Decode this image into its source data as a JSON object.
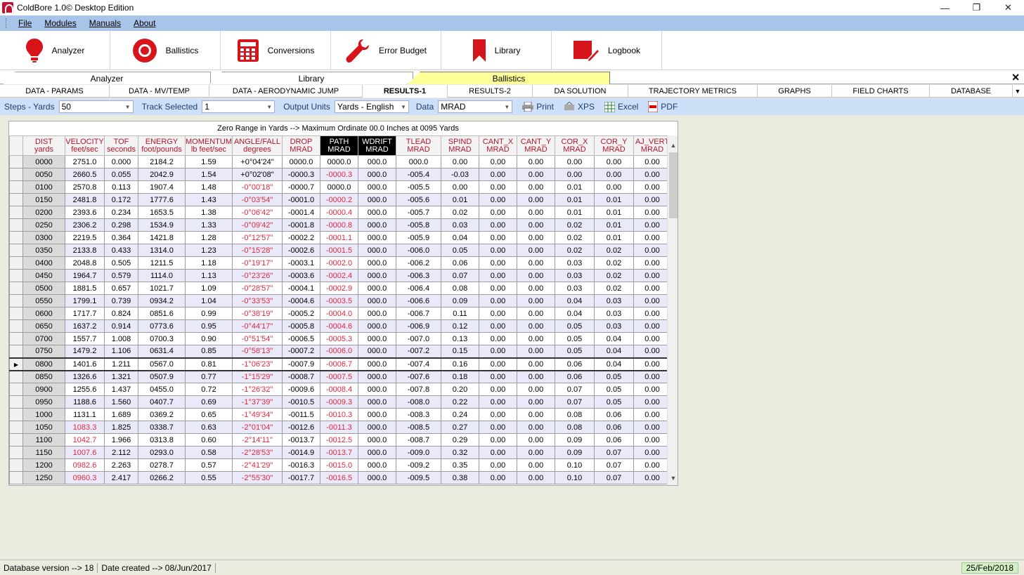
{
  "window": {
    "title": "ColdBore 1.0© Desktop Edition"
  },
  "menu": [
    "File",
    "Modules",
    "Manuals",
    "About"
  ],
  "toolbar": [
    "Analyzer",
    "Ballistics",
    "Conversions",
    "Error Budget",
    "Library",
    "Logbook"
  ],
  "module_tabs": [
    "Analyzer",
    "Library",
    "Ballistics"
  ],
  "sub_tabs": [
    "DATA - PARAMS",
    "DATA - MV/TEMP",
    "DATA - AERODYNAMIC JUMP",
    "RESULTS-1",
    "RESULTS-2",
    "DA SOLUTION",
    "TRAJECTORY METRICS",
    "GRAPHS",
    "FIELD CHARTS",
    "DATABASE"
  ],
  "options": {
    "steps_label": "Steps - Yards",
    "steps_value": "50",
    "track_label": "Track Selected",
    "track_value": "1",
    "units_label": "Output Units",
    "units_value": "Yards - English",
    "data_label": "Data",
    "data_value": "MRAD",
    "print": "Print",
    "xps": "XPS",
    "excel": "Excel",
    "pdf": "PDF"
  },
  "grid": {
    "caption": "Zero Range in Yards --> Maximum Ordinate 00.0 Inches at 0095 Yards",
    "columns": [
      [
        "DIST",
        "yards"
      ],
      [
        "VELOCITY",
        "feet/sec"
      ],
      [
        "TOF",
        "seconds"
      ],
      [
        "ENERGY",
        "foot/pounds"
      ],
      [
        "MOMENTUM",
        "lb feet/sec"
      ],
      [
        "ANGLE/FALL",
        "degrees"
      ],
      [
        "DROP",
        "MRAD"
      ],
      [
        "PATH",
        "MRAD"
      ],
      [
        "WDRIFT",
        "MRAD"
      ],
      [
        "TLEAD",
        "MRAD"
      ],
      [
        "SPIND",
        "MRAD"
      ],
      [
        "CANT_X",
        "MRAD"
      ],
      [
        "CANT_Y",
        "MRAD"
      ],
      [
        "COR_X",
        "MRAD"
      ],
      [
        "COR_Y",
        "MRAD"
      ],
      [
        "AJ_VERT",
        "MRAD"
      ]
    ],
    "rows": [
      [
        "0000",
        "2751.0",
        "0.000",
        "2184.2",
        "1.59",
        "+0°04'24\"",
        "0000.0",
        "0000.0",
        "000.0",
        "000.0",
        "0.00",
        "0.00",
        "0.00",
        "0.00",
        "0.00",
        "0.00"
      ],
      [
        "0050",
        "2660.5",
        "0.055",
        "2042.9",
        "1.54",
        "+0°02'08\"",
        "-0000.3",
        "-0000.3",
        "000.0",
        "-005.4",
        "-0.03",
        "0.00",
        "0.00",
        "0.00",
        "0.00",
        "0.00"
      ],
      [
        "0100",
        "2570.8",
        "0.113",
        "1907.4",
        "1.48",
        "-0°00'18\"",
        "-0000.7",
        "0000.0",
        "000.0",
        "-005.5",
        "0.00",
        "0.00",
        "0.00",
        "0.01",
        "0.00",
        "0.00"
      ],
      [
        "0150",
        "2481.8",
        "0.172",
        "1777.6",
        "1.43",
        "-0°03'54\"",
        "-0001.0",
        "-0000.2",
        "000.0",
        "-005.6",
        "0.01",
        "0.00",
        "0.00",
        "0.01",
        "0.01",
        "0.00"
      ],
      [
        "0200",
        "2393.6",
        "0.234",
        "1653.5",
        "1.38",
        "-0°06'42\"",
        "-0001.4",
        "-0000.4",
        "000.0",
        "-005.7",
        "0.02",
        "0.00",
        "0.00",
        "0.01",
        "0.01",
        "0.00"
      ],
      [
        "0250",
        "2306.2",
        "0.298",
        "1534.9",
        "1.33",
        "-0°09'42\"",
        "-0001.8",
        "-0000.8",
        "000.0",
        "-005.8",
        "0.03",
        "0.00",
        "0.00",
        "0.02",
        "0.01",
        "0.00"
      ],
      [
        "0300",
        "2219.5",
        "0.364",
        "1421.8",
        "1.28",
        "-0°12'57\"",
        "-0002.2",
        "-0001.1",
        "000.0",
        "-005.9",
        "0.04",
        "0.00",
        "0.00",
        "0.02",
        "0.01",
        "0.00"
      ],
      [
        "0350",
        "2133.8",
        "0.433",
        "1314.0",
        "1.23",
        "-0°15'28\"",
        "-0002.6",
        "-0001.5",
        "000.0",
        "-006.0",
        "0.05",
        "0.00",
        "0.00",
        "0.02",
        "0.02",
        "0.00"
      ],
      [
        "0400",
        "2048.8",
        "0.505",
        "1211.5",
        "1.18",
        "-0°19'17\"",
        "-0003.1",
        "-0002.0",
        "000.0",
        "-006.2",
        "0.06",
        "0.00",
        "0.00",
        "0.03",
        "0.02",
        "0.00"
      ],
      [
        "0450",
        "1964.7",
        "0.579",
        "1114.0",
        "1.13",
        "-0°23'26\"",
        "-0003.6",
        "-0002.4",
        "000.0",
        "-006.3",
        "0.07",
        "0.00",
        "0.00",
        "0.03",
        "0.02",
        "0.00"
      ],
      [
        "0500",
        "1881.5",
        "0.657",
        "1021.7",
        "1.09",
        "-0°28'57\"",
        "-0004.1",
        "-0002.9",
        "000.0",
        "-006.4",
        "0.08",
        "0.00",
        "0.00",
        "0.03",
        "0.02",
        "0.00"
      ],
      [
        "0550",
        "1799.1",
        "0.739",
        "0934.2",
        "1.04",
        "-0°33'53\"",
        "-0004.6",
        "-0003.5",
        "000.0",
        "-006.6",
        "0.09",
        "0.00",
        "0.00",
        "0.04",
        "0.03",
        "0.00"
      ],
      [
        "0600",
        "1717.7",
        "0.824",
        "0851.6",
        "0.99",
        "-0°38'19\"",
        "-0005.2",
        "-0004.0",
        "000.0",
        "-006.7",
        "0.11",
        "0.00",
        "0.00",
        "0.04",
        "0.03",
        "0.00"
      ],
      [
        "0650",
        "1637.2",
        "0.914",
        "0773.6",
        "0.95",
        "-0°44'17\"",
        "-0005.8",
        "-0004.6",
        "000.0",
        "-006.9",
        "0.12",
        "0.00",
        "0.00",
        "0.05",
        "0.03",
        "0.00"
      ],
      [
        "0700",
        "1557.7",
        "1.008",
        "0700.3",
        "0.90",
        "-0°51'54\"",
        "-0006.5",
        "-0005.3",
        "000.0",
        "-007.0",
        "0.13",
        "0.00",
        "0.00",
        "0.05",
        "0.04",
        "0.00"
      ],
      [
        "0750",
        "1479.2",
        "1.106",
        "0631.4",
        "0.85",
        "-0°58'13\"",
        "-0007.2",
        "-0006.0",
        "000.0",
        "-007.2",
        "0.15",
        "0.00",
        "0.00",
        "0.05",
        "0.04",
        "0.00"
      ],
      [
        "0800",
        "1401.6",
        "1.211",
        "0567.0",
        "0.81",
        "-1°06'23\"",
        "-0007.9",
        "-0006.7",
        "000.0",
        "-007.4",
        "0.16",
        "0.00",
        "0.00",
        "0.06",
        "0.04",
        "0.00"
      ],
      [
        "0850",
        "1326.6",
        "1.321",
        "0507.9",
        "0.77",
        "-1°15'29\"",
        "-0008.7",
        "-0007.5",
        "000.0",
        "-007.6",
        "0.18",
        "0.00",
        "0.00",
        "0.06",
        "0.05",
        "0.00"
      ],
      [
        "0900",
        "1255.6",
        "1.437",
        "0455.0",
        "0.72",
        "-1°26'32\"",
        "-0009.6",
        "-0008.4",
        "000.0",
        "-007.8",
        "0.20",
        "0.00",
        "0.00",
        "0.07",
        "0.05",
        "0.00"
      ],
      [
        "0950",
        "1188.6",
        "1.560",
        "0407.7",
        "0.69",
        "-1°37'39\"",
        "-0010.5",
        "-0009.3",
        "000.0",
        "-008.0",
        "0.22",
        "0.00",
        "0.00",
        "0.07",
        "0.05",
        "0.00"
      ],
      [
        "1000",
        "1131.1",
        "1.689",
        "0369.2",
        "0.65",
        "-1°49'34\"",
        "-0011.5",
        "-0010.3",
        "000.0",
        "-008.3",
        "0.24",
        "0.00",
        "0.00",
        "0.08",
        "0.06",
        "0.00"
      ],
      [
        "1050",
        "1083.3",
        "1.825",
        "0338.7",
        "0.63",
        "-2°01'04\"",
        "-0012.6",
        "-0011.3",
        "000.0",
        "-008.5",
        "0.27",
        "0.00",
        "0.00",
        "0.08",
        "0.06",
        "0.00"
      ],
      [
        "1100",
        "1042.7",
        "1.966",
        "0313.8",
        "0.60",
        "-2°14'11\"",
        "-0013.7",
        "-0012.5",
        "000.0",
        "-008.7",
        "0.29",
        "0.00",
        "0.00",
        "0.09",
        "0.06",
        "0.00"
      ],
      [
        "1150",
        "1007.6",
        "2.112",
        "0293.0",
        "0.58",
        "-2°28'53\"",
        "-0014.9",
        "-0013.7",
        "000.0",
        "-009.0",
        "0.32",
        "0.00",
        "0.00",
        "0.09",
        "0.07",
        "0.00"
      ],
      [
        "1200",
        "0982.6",
        "2.263",
        "0278.7",
        "0.57",
        "-2°41'29\"",
        "-0016.3",
        "-0015.0",
        "000.0",
        "-009.2",
        "0.35",
        "0.00",
        "0.00",
        "0.10",
        "0.07",
        "0.00"
      ],
      [
        "1250",
        "0960.3",
        "2.417",
        "0266.2",
        "0.55",
        "-2°55'30\"",
        "-0017.7",
        "-0016.5",
        "000.0",
        "-009.5",
        "0.38",
        "0.00",
        "0.00",
        "0.10",
        "0.07",
        "0.00"
      ]
    ],
    "selected_row": 16,
    "subsonic_from_row": 21
  },
  "status": {
    "db_version": "Database version --> 18",
    "date_created": "Date created --> 08/Jun/2017",
    "today": "25/Feb/2018"
  },
  "colors": {
    "accent_red": "#C8102E",
    "negative_red": "#E0283C",
    "menu_blue": "#A9C4E9",
    "active_tab": "#FFFF99"
  }
}
